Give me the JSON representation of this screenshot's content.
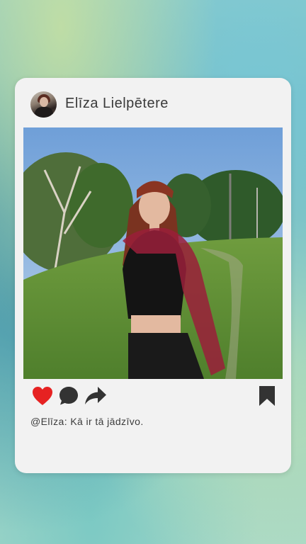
{
  "post": {
    "author_name": "Elīza Lielpētere",
    "caption": "@Elīza: Kā ir tā jādzīvo.",
    "avatar_icon": "profile-photo",
    "photo_description_icon": "post-photo"
  },
  "actions": {
    "like_icon": "heart-icon",
    "comment_icon": "comment-bubble-icon",
    "share_icon": "share-arrow-icon",
    "save_icon": "bookmark-icon",
    "like_color": "#e62222",
    "icon_color": "#333333"
  },
  "colors": {
    "card_background": "#f2f2f2",
    "text": "#3a3a3a"
  }
}
